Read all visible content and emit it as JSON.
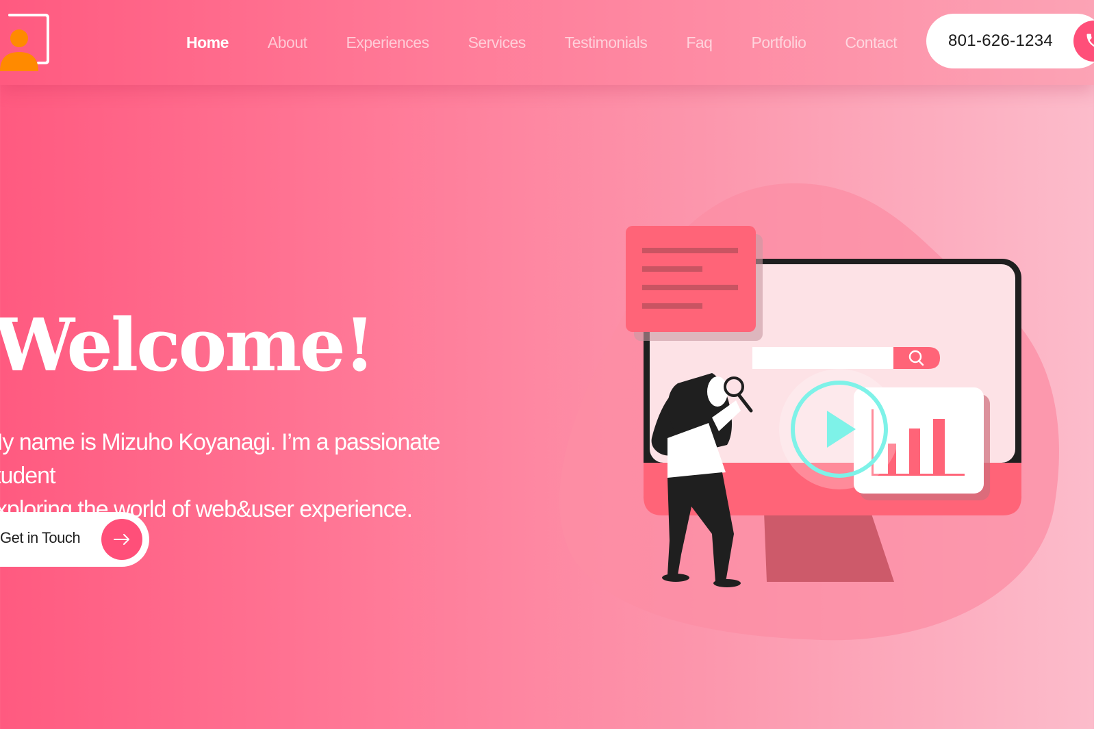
{
  "nav": {
    "items": [
      {
        "label": "Home"
      },
      {
        "label": "About"
      },
      {
        "label": "Experiences"
      },
      {
        "label": "Services"
      },
      {
        "label": "Testimonials"
      },
      {
        "label": "Faq"
      },
      {
        "label": "Portfolio"
      },
      {
        "label": "Contact"
      }
    ],
    "active": "Home"
  },
  "contact": {
    "phone": "801-626-1234"
  },
  "hero": {
    "title": "Welcome!",
    "intro_line1": "My name is Mizuho Koyanagi. I’m a passionate student",
    "intro_line2": "exploring the world of web&user experience.",
    "cta_label": "Get in Touch"
  },
  "colors": {
    "accent": "#ff4f79",
    "logo_orange": "#ff8a00",
    "play_cyan": "#7ef2e8"
  },
  "icons": {
    "logo": "person-presentation-icon",
    "phone": "phone-icon",
    "cta": "arrow-right-icon",
    "search": "search-icon",
    "play": "play-icon"
  }
}
